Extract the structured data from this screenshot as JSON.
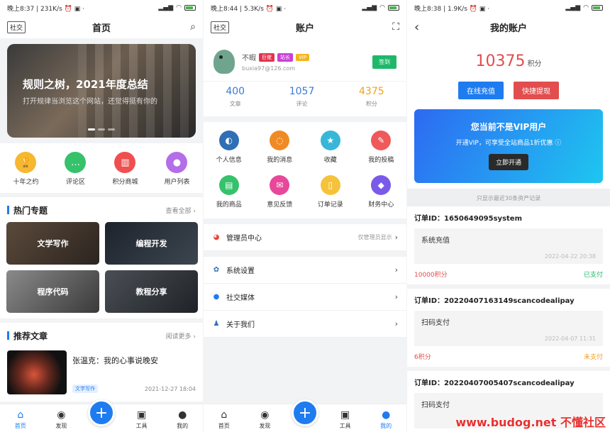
{
  "status_bars": [
    {
      "left": "晚上8:37 | 231K/s ⏰ ▣ ·",
      "battery": "67"
    },
    {
      "left": "晚上8:44 | 5.3K/s ⏰ ▣ ·",
      "battery": "65"
    },
    {
      "left": "晚上8:38 | 1.9K/s ⏰ ▣ ·",
      "battery": "67"
    }
  ],
  "home": {
    "tag": "社交",
    "title": "首页",
    "banner": {
      "title": "规则之树，2021年度总结",
      "subtitle": "打开规律当浏览这个网站，还觉得挺有你的"
    },
    "quick": [
      {
        "label": "十年之约",
        "icon": "🏆",
        "color": "#f5b82e"
      },
      {
        "label": "评论区",
        "icon": "…",
        "color": "#35c26b"
      },
      {
        "label": "积分商城",
        "icon": "▥",
        "color": "#ef4f4f"
      },
      {
        "label": "用户列表",
        "icon": "●",
        "color": "#b36ee8"
      }
    ],
    "hot": {
      "title": "热门专题",
      "more": "查看全部 ›",
      "topics": [
        "文学写作",
        "编程开发",
        "程序代码",
        "教程分享"
      ]
    },
    "recommend": {
      "title": "推荐文章",
      "more": "阅读更多 ›",
      "article": {
        "title": "张温克：我的心事说晚安",
        "tag": "文学写作",
        "date": "2021-12-27 18:04"
      }
    }
  },
  "tabs": [
    {
      "label": "首页",
      "icon": "⌂"
    },
    {
      "label": "发现",
      "icon": "◉"
    },
    {
      "label": "工具",
      "icon": "▣"
    },
    {
      "label": "我的",
      "icon": "●"
    }
  ],
  "fab_icon": "+",
  "account": {
    "tag": "社交",
    "title": "账户",
    "scan_icon": "⛶",
    "user": {
      "name": "不暇",
      "badges": [
        {
          "text": "巨佬",
          "color": "#e2334d"
        },
        {
          "text": "站长",
          "color": "#c93fd6"
        },
        {
          "text": "VIP",
          "color": "#f3b51a"
        }
      ],
      "email": "buxia97@126.com"
    },
    "checkin": "签到",
    "stats": [
      {
        "num": "400",
        "label": "文章",
        "color": "#3a7bd5"
      },
      {
        "num": "1057",
        "label": "评论",
        "color": "#3a7bd5"
      },
      {
        "num": "4375",
        "label": "积分",
        "color": "#f0a020"
      }
    ],
    "grid": [
      {
        "label": "个人信息",
        "icon": "◐",
        "color": "#2f6fb5"
      },
      {
        "label": "我的消息",
        "icon": "◌",
        "color": "#f08a24"
      },
      {
        "label": "收藏",
        "icon": "★",
        "color": "#36b7d9"
      },
      {
        "label": "我的投稿",
        "icon": "✎",
        "color": "#ef5959"
      },
      {
        "label": "我的商品",
        "icon": "▤",
        "color": "#35c26b"
      },
      {
        "label": "意见反馈",
        "icon": "✉",
        "color": "#e8489a"
      },
      {
        "label": "订单记录",
        "icon": "▯",
        "color": "#f5c33a"
      },
      {
        "label": "财务中心",
        "icon": "◆",
        "color": "#7a5ae8"
      }
    ],
    "admin": {
      "label": "管理员中心",
      "hint": "仅管理员显示",
      "icon": "◕",
      "icon_color": "#e8463a"
    },
    "menu": [
      {
        "label": "系统设置",
        "icon": "✿",
        "icon_color": "#2f6fb5"
      },
      {
        "label": "社交媒体",
        "icon": "●",
        "icon_color": "#1e7cf0"
      },
      {
        "label": "关于我们",
        "icon": "♟",
        "icon_color": "#2f6fb5"
      }
    ]
  },
  "myaccount": {
    "back_icon": "‹",
    "title": "我的账户",
    "points": "10375",
    "unit": "积分",
    "recharge": "在线充值",
    "withdraw": "快捷提现",
    "vip": {
      "title": "您当前不是VIP用户",
      "desc": "开通VIP，可享受全站商品1折优惠 ⓘ",
      "button": "立即开通"
    },
    "hint": "只显示最近30条资产记录",
    "records": [
      {
        "oid": "订单ID：1650649095system",
        "type": "系统充值",
        "time": "2022-04-22 20:38",
        "amount": "10000积分",
        "status": "已支付",
        "paid": true
      },
      {
        "oid": "订单ID：20220407163149scancodealipay",
        "type": "扫码支付",
        "time": "2022-04-07 11:31",
        "amount": "6积分",
        "status": "未支付",
        "paid": false
      },
      {
        "oid": "订单ID：20220407005407scancodealipay",
        "type": "扫码支付",
        "time": "",
        "amount": "",
        "status": "",
        "paid": false
      }
    ]
  },
  "watermark": "www.budog.net 不懂社区",
  "colors": {
    "accent": "#1e7cf0",
    "danger": "#e24d4d",
    "success": "#1fb86b",
    "warning": "#f0a020"
  }
}
